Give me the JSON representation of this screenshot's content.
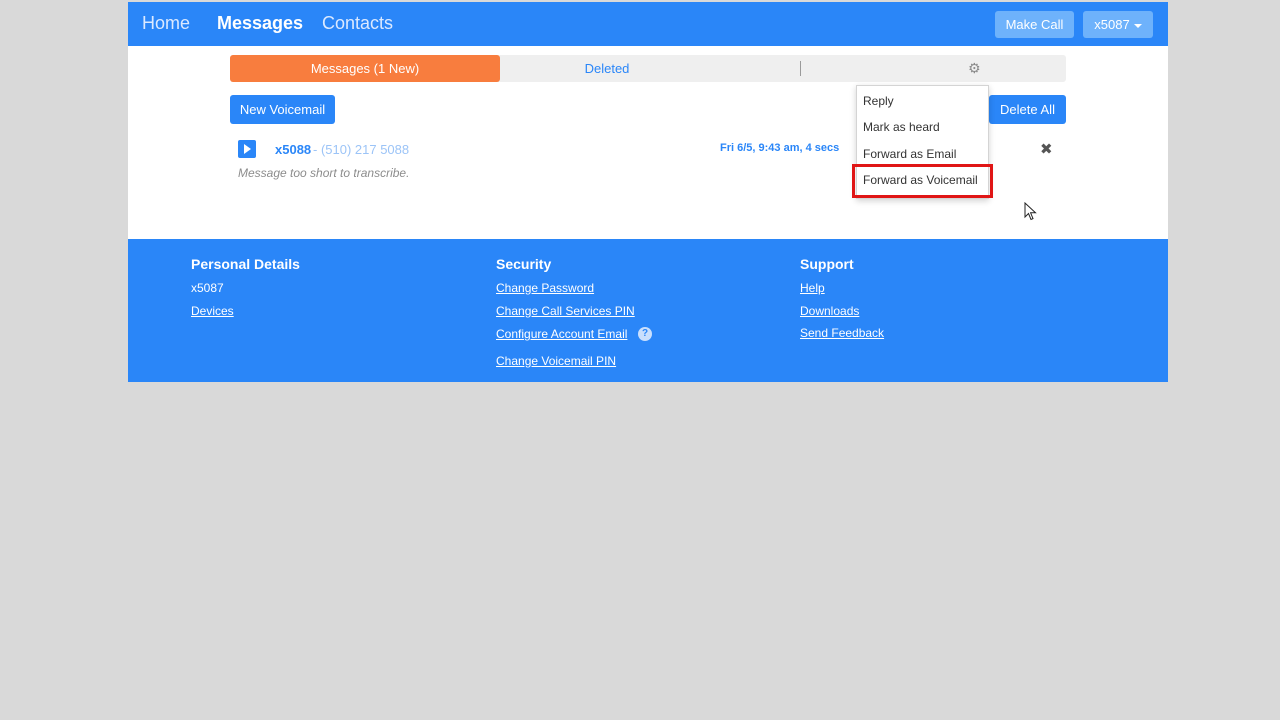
{
  "nav": {
    "home": "Home",
    "messages": "Messages",
    "contacts": "Contacts",
    "make_call": "Make Call",
    "user": "x5087"
  },
  "tabs": {
    "messages": "Messages (1 New)",
    "deleted": "Deleted",
    "settings_icon": "gear-icon"
  },
  "actions": {
    "new_voicemail": "New Voicemail",
    "delete_all": "Delete All"
  },
  "message": {
    "from": "x5088",
    "number": "- (510) 217 5088",
    "time": "Fri 6/5, 9:43 am, 4 secs",
    "transcript": "Message too short to transcribe."
  },
  "menu": {
    "items": [
      "Reply",
      "Mark as heard",
      "Forward as Email",
      "Forward as Voicemail"
    ],
    "highlighted": "Forward as Voicemail"
  },
  "footer": {
    "personal": {
      "heading": "Personal Details",
      "extension": "x5087",
      "devices": "Devices"
    },
    "security": {
      "heading": "Security",
      "change_password": "Change Password",
      "change_call_pin": "Change Call Services PIN",
      "configure_email": "Configure Account Email",
      "change_voicemail_pin": "Change Voicemail PIN"
    },
    "support": {
      "heading": "Support",
      "help": "Help",
      "downloads": "Downloads",
      "send_feedback": "Send Feedback"
    }
  },
  "colors": {
    "primary": "#2a86f8",
    "active_tab": "#f87d3e",
    "highlight": "#e01515",
    "background": "#d9d9d9"
  }
}
